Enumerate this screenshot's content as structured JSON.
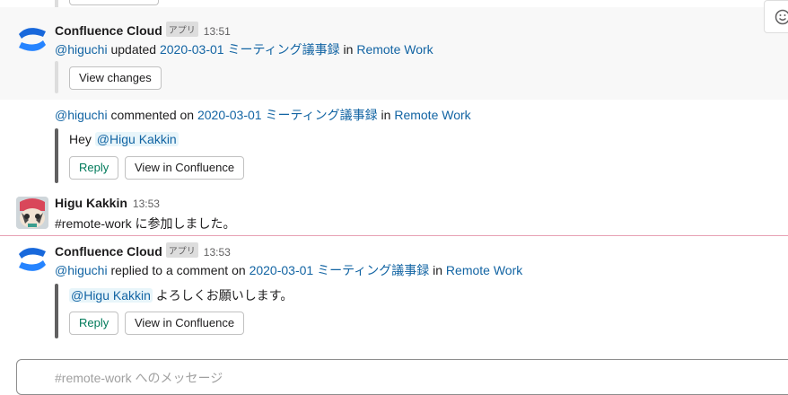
{
  "messages": [
    {
      "author": "Confluence Cloud",
      "badge": "アプリ",
      "time": "13:51",
      "user": "@higuchi",
      "action": " updated ",
      "page": "2020-03-01 ミーティング議事録",
      "in_word": " in ",
      "space": "Remote Work",
      "button": "View changes"
    },
    {
      "user": "@higuchi",
      "action": " commented on ",
      "page": "2020-03-01 ミーティング議事録",
      "in_word": " in ",
      "space": "Remote Work",
      "comment_prefix": "Hey ",
      "mention": "@Higu Kakkin",
      "reply": "Reply",
      "view": "View in Confluence"
    },
    {
      "author": "Higu Kakkin",
      "time": "13:53",
      "channel": "#remote-work",
      "text": " に参加しました。"
    },
    {
      "author": "Confluence Cloud",
      "badge": "アプリ",
      "time": "13:53",
      "user": "@higuchi",
      "action": " replied to a comment on ",
      "page": "2020-03-01 ミーティング議事録",
      "in_word": " in ",
      "space": "Remote Work",
      "mention": "@Higu Kakkin",
      "comment_suffix": " よろしくお願いします。",
      "reply": "Reply",
      "view": "View in Confluence"
    }
  ],
  "composer": {
    "placeholder": "#remote-work へのメッセージ"
  },
  "colors": {
    "link": "#1264a3",
    "green": "#007a5a",
    "new_divider": "#e8a1b4",
    "hover_bg": "#f8f8f8"
  }
}
